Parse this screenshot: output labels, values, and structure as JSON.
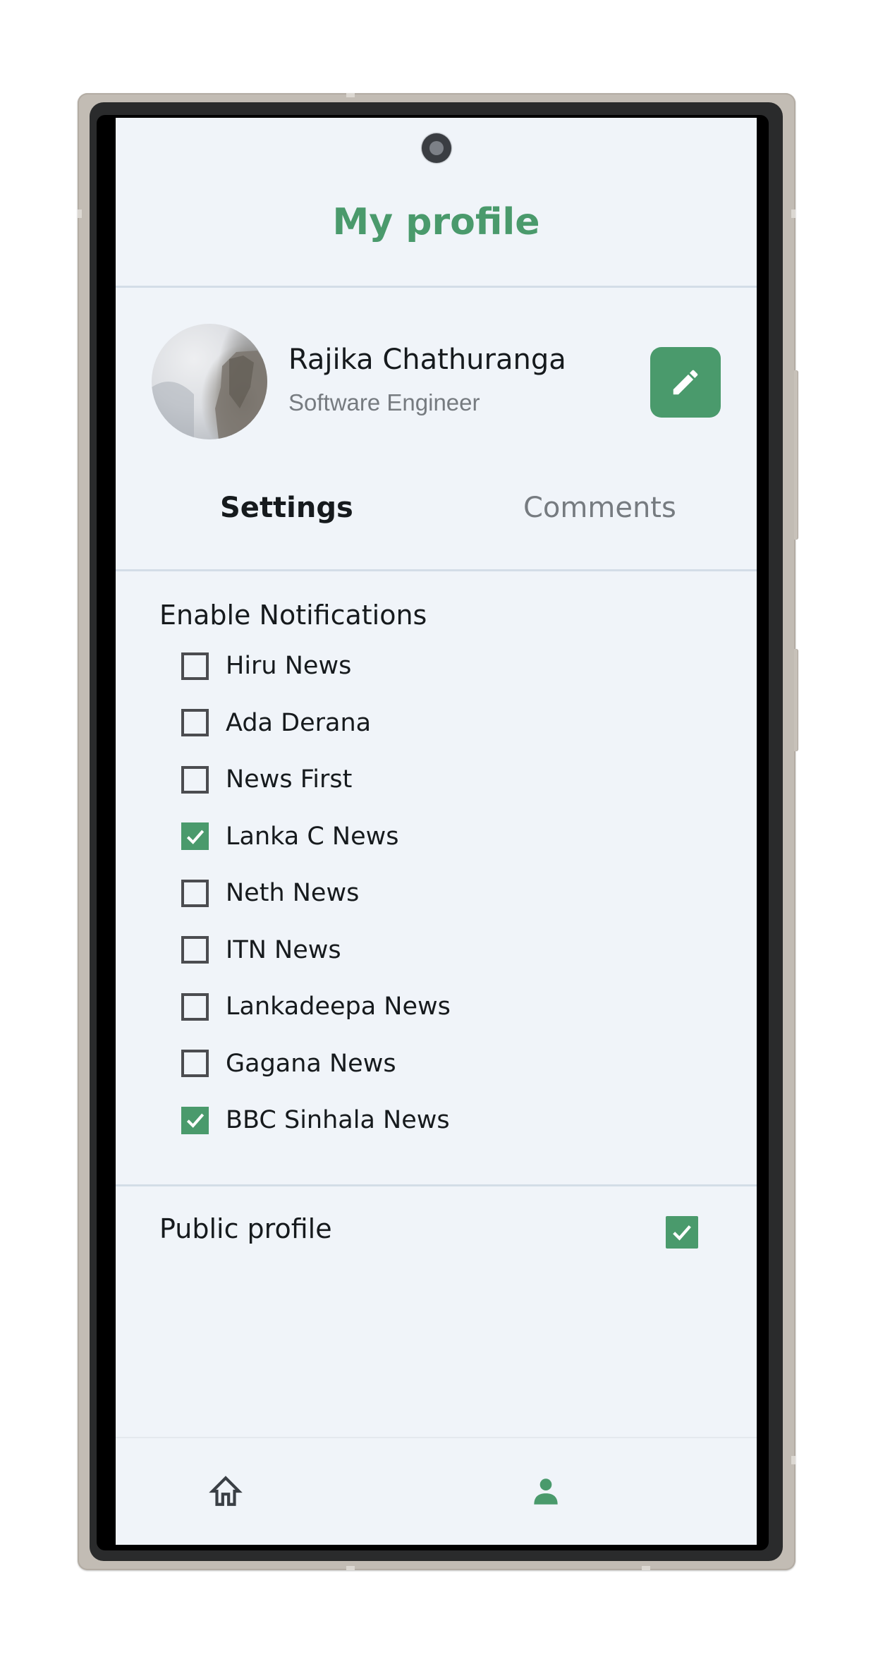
{
  "header": {
    "title": "My profile"
  },
  "profile": {
    "name": "Rajika Chathuranga",
    "role": "Software Engineer",
    "avatar_icon": "profile-photo",
    "edit_icon": "pencil-icon"
  },
  "tabs": [
    {
      "label": "Settings",
      "active": true
    },
    {
      "label": "Comments",
      "active": false
    }
  ],
  "notifications": {
    "title": "Enable Notifications",
    "items": [
      {
        "label": "Hiru News",
        "checked": false
      },
      {
        "label": "Ada Derana",
        "checked": false
      },
      {
        "label": "News First",
        "checked": false
      },
      {
        "label": "Lanka C News",
        "checked": true
      },
      {
        "label": "Neth News",
        "checked": false
      },
      {
        "label": "ITN News",
        "checked": false
      },
      {
        "label": "Lankadeepa News",
        "checked": false
      },
      {
        "label": "Gagana News",
        "checked": false
      },
      {
        "label": "BBC Sinhala News",
        "checked": true
      }
    ]
  },
  "public_profile": {
    "label": "Public profile",
    "checked": true
  },
  "bottom_nav": [
    {
      "name": "home",
      "icon": "home-icon",
      "active": false
    },
    {
      "name": "profile",
      "icon": "person-icon",
      "active": true
    }
  ],
  "colors": {
    "accent": "#4a9a6c",
    "text": "#161a1d",
    "muted": "#767b80",
    "background": "#f0f4f9",
    "divider": "#d3dde7"
  }
}
